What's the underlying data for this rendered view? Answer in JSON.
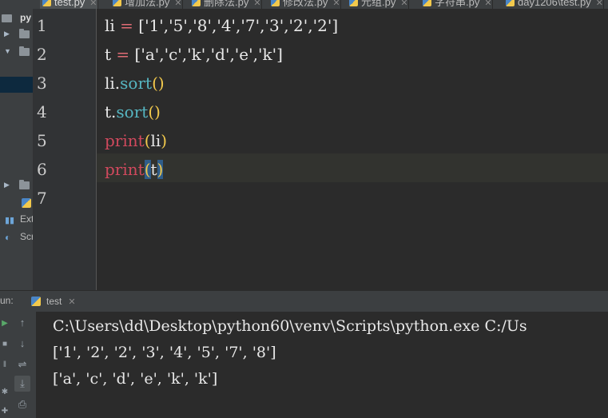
{
  "tabs": [
    {
      "label": "test.py",
      "active": true
    },
    {
      "label": "增加法.py",
      "active": false
    },
    {
      "label": "删除法.py",
      "active": false
    },
    {
      "label": "修改法.py",
      "active": false
    },
    {
      "label": "元组.py",
      "active": false
    },
    {
      "label": "字符串.py",
      "active": false
    },
    {
      "label": "day1206\\test.py",
      "active": false
    }
  ],
  "project_panel": {
    "root_label": "py",
    "externals_label": "Ext",
    "scratches_label": "Scr"
  },
  "editor": {
    "line_numbers": [
      "1",
      "2",
      "3",
      "4",
      "5",
      "6",
      "7"
    ],
    "lines": {
      "l1_var": "li",
      "l1_eq": " = ",
      "l1_val": "['1','5','8','4','7','3','2','2']",
      "l2_var": "t",
      "l2_eq": " = ",
      "l2_val": "['a','c','k','d','e','k']",
      "l3_obj": "li.",
      "l3_fn": "sort",
      "l3_paren": "()",
      "l4_obj": "t.",
      "l4_fn": "sort",
      "l4_paren": "()",
      "l5_kw": "print",
      "l5_open": "(",
      "l5_arg": "li",
      "l5_close": ")",
      "l6_kw": "print",
      "l6_open": "(",
      "l6_arg": "t",
      "l6_close": ")"
    }
  },
  "run": {
    "label": "un:",
    "tab_label": "test",
    "output": [
      "C:\\Users\\dd\\Desktop\\python60\\venv\\Scripts\\python.exe C:/Us",
      "['1', '2', '2', '3', '4', '5', '7', '8']",
      "['a', 'c', 'd', 'e', 'k', 'k']"
    ]
  },
  "colors": {
    "editor_bg": "#2b2b2b",
    "keyword_print": "#d0495d",
    "method": "#56b6c2",
    "paren": "#f2c94c",
    "bracket_highlight": "#2f5d8a"
  }
}
